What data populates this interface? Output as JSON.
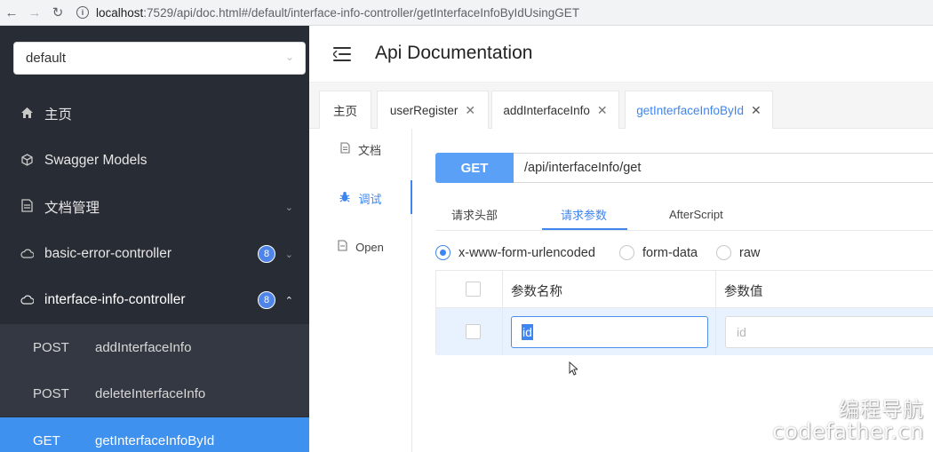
{
  "browser": {
    "url_host": "localhost",
    "url_rest": ":7529/api/doc.html#/default/interface-info-controller/getInterfaceInfoByIdUsingGET"
  },
  "sidebar": {
    "group_select": "default",
    "items": [
      {
        "label": "主页",
        "icon": "home-icon"
      },
      {
        "label": "Swagger Models",
        "icon": "cube-icon"
      },
      {
        "label": "文档管理",
        "icon": "document-icon"
      },
      {
        "label": "basic-error-controller",
        "icon": "cloud-icon",
        "badge": "8"
      },
      {
        "label": "interface-info-controller",
        "icon": "cloud-icon",
        "badge": "8"
      }
    ],
    "operations": [
      {
        "method": "POST",
        "name": "addInterfaceInfo"
      },
      {
        "method": "POST",
        "name": "deleteInterfaceInfo"
      },
      {
        "method": "GET",
        "name": "getInterfaceInfoById"
      }
    ]
  },
  "header": {
    "title": "Api Documentation"
  },
  "tabs": [
    {
      "label": "主页"
    },
    {
      "label": "userRegister"
    },
    {
      "label": "addInterfaceInfo"
    },
    {
      "label": "getInterfaceInfoById"
    }
  ],
  "side_tabs": [
    {
      "label": "文档"
    },
    {
      "label": "调试"
    },
    {
      "label": "Open"
    }
  ],
  "request": {
    "method": "GET",
    "path": "/api/interfaceInfo/get"
  },
  "sub_tabs": [
    {
      "label": "请求头部"
    },
    {
      "label": "请求参数"
    },
    {
      "label": "AfterScript"
    }
  ],
  "body_types": [
    {
      "label": "x-www-form-urlencoded",
      "checked": true
    },
    {
      "label": "form-data",
      "checked": false
    },
    {
      "label": "raw",
      "checked": false
    }
  ],
  "params_table": {
    "col_name": "参数名称",
    "col_value": "参数值",
    "rows": [
      {
        "name": "id",
        "value_placeholder": "id"
      }
    ]
  },
  "watermark": {
    "line1": "编程导航",
    "line2": "codefather.cn"
  },
  "colors": {
    "accent": "#3f85ef",
    "sidebar_bg": "#282c34",
    "active_op_bg": "#3f91ef",
    "method_btn": "#5aa0f6"
  }
}
